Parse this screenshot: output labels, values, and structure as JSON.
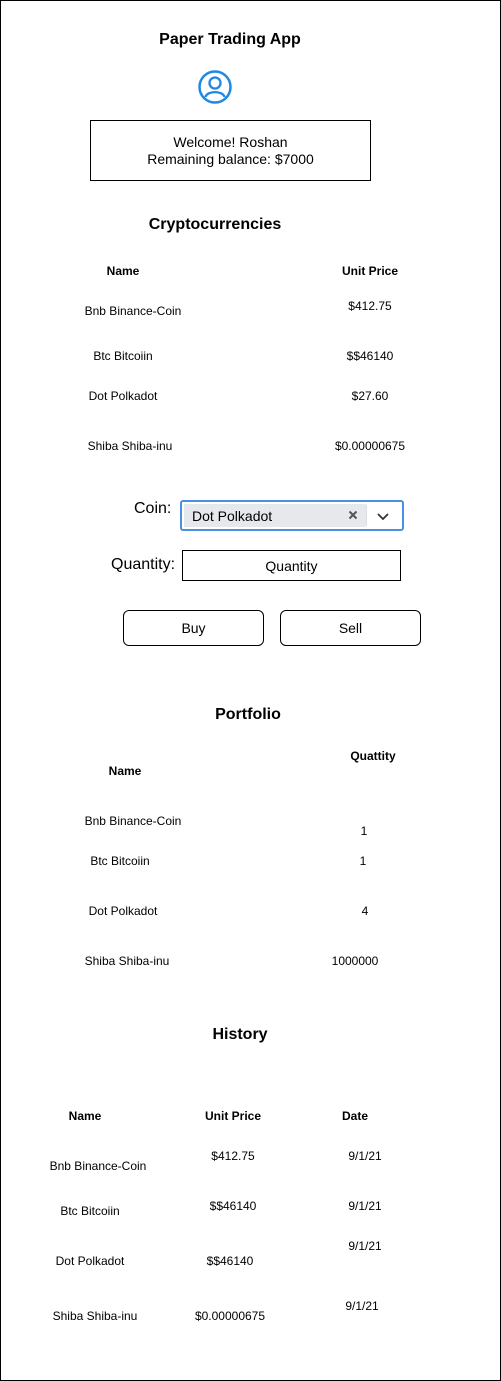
{
  "app": {
    "title": "Paper Trading App"
  },
  "welcome": {
    "line1": "Welcome! Roshan",
    "line2": "Remaining balance: $7000"
  },
  "crypto": {
    "title": "Cryptocurrencies",
    "headers": {
      "name": "Name",
      "price": "Unit Price"
    },
    "rows": [
      {
        "name": "Bnb Binance-Coin",
        "price": "$412.75"
      },
      {
        "name": "Btc Bitcoiin",
        "price": "$$46140"
      },
      {
        "name": "Dot Polkadot",
        "price": "$27.60"
      },
      {
        "name": "Shiba Shiba-inu",
        "price": "$0.00000675"
      }
    ]
  },
  "trade": {
    "coin_label": "Coin:",
    "coin_selected": "Dot Polkadot",
    "quantity_label": "Quantity:",
    "quantity_placeholder": "Quantity",
    "buy_label": "Buy",
    "sell_label": "Sell"
  },
  "portfolio": {
    "title": "Portfolio",
    "headers": {
      "name": "Name",
      "quantity": "Quattity"
    },
    "rows": [
      {
        "name": "Bnb Binance-Coin",
        "quantity": "1"
      },
      {
        "name": "Btc Bitcoiin",
        "quantity": "1"
      },
      {
        "name": "Dot Polkadot",
        "quantity": "4"
      },
      {
        "name": "Shiba Shiba-inu",
        "quantity": "1000000"
      }
    ]
  },
  "history": {
    "title": "History",
    "headers": {
      "name": "Name",
      "price": "Unit Price",
      "date": "Date"
    },
    "rows": [
      {
        "name": "Bnb Binance-Coin",
        "price": "$412.75",
        "date": "9/1/21"
      },
      {
        "name": "Btc Bitcoiin",
        "price": "$$46140",
        "date": "9/1/21"
      },
      {
        "name": "Dot Polkadot",
        "price": "$$46140",
        "date": "9/1/21"
      },
      {
        "name": "Shiba Shiba-inu",
        "price": "$0.00000675",
        "date": "9/1/21"
      }
    ]
  },
  "colors": {
    "accent": "#4a90e2",
    "user_icon": "#1e88e5"
  }
}
